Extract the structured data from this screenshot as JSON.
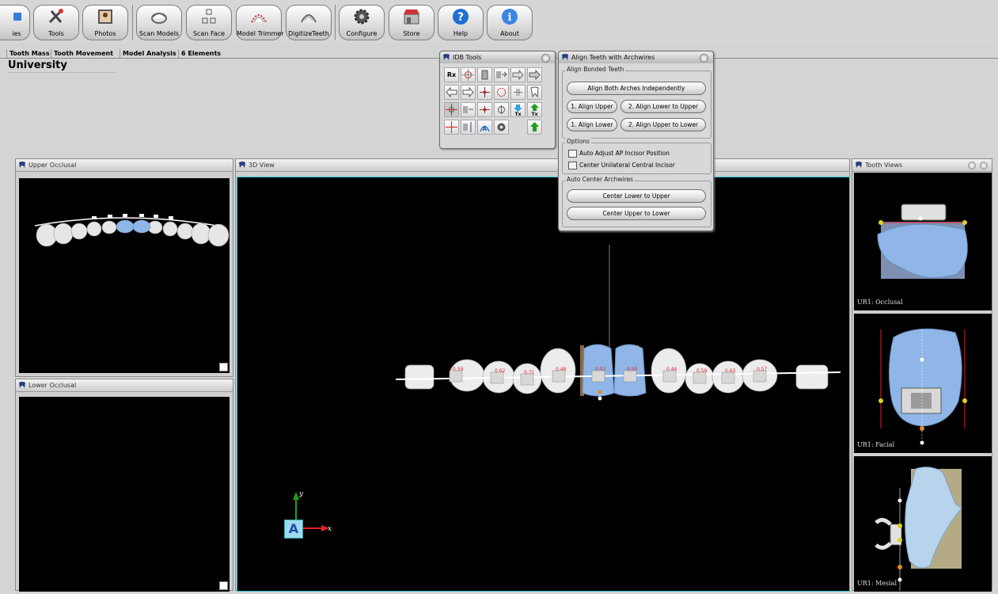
{
  "toolbar": {
    "buttons": [
      {
        "label": "ies",
        "icon": "blue-cube-icon"
      },
      {
        "label": "Tools",
        "icon": "tools-icon"
      },
      {
        "label": "Photos",
        "icon": "photo-icon"
      },
      {
        "label": "Scan Models",
        "icon": "scan-model-icon"
      },
      {
        "label": "Scan Face",
        "icon": "scan-face-icon"
      },
      {
        "label": "Model Trimmer",
        "icon": "model-trimmer-icon"
      },
      {
        "label": "DigitizeTeeth",
        "icon": "digitize-teeth-icon"
      },
      {
        "label": "Configure",
        "icon": "gear-icon"
      },
      {
        "label": "Store",
        "icon": "store-icon"
      },
      {
        "label": "Help",
        "icon": "help-icon"
      },
      {
        "label": "About",
        "icon": "info-icon"
      }
    ]
  },
  "tabs": [
    {
      "label": "Tooth Mass"
    },
    {
      "label": "Tooth Movement"
    },
    {
      "label": "Model Analysis"
    },
    {
      "label": "6 Elements"
    }
  ],
  "header": {
    "title": "University"
  },
  "panels": {
    "upper_occlusal": "Upper Occlusal",
    "lower_occlusal": "Lower Occlusal",
    "view3d": "3D View",
    "tooth_views": "Tooth Views"
  },
  "tooth_views": {
    "occlusal_label": "UR1: Occlusal",
    "facial_label": "UR1: Facial",
    "mesial_label": "UR1: Mesial"
  },
  "idb_tools": {
    "title": "IDB Tools",
    "rx_label": "Rx",
    "tx_label": "Tx",
    "a_label": "A"
  },
  "align_dialog": {
    "title": "Align Teeth with Archwires",
    "bonded_group": "Align Bonded Teeth",
    "align_both": "Align Both Arches Independently",
    "align_upper": "1. Align Upper",
    "align_lower_to_upper": "2. Align Lower to Upper",
    "align_lower": "1. Align Lower",
    "align_upper_to_lower": "2. Align Upper to Lower",
    "options_group": "Options",
    "opt_auto_adjust": "Auto Adjust AP Incisor Position",
    "opt_center_unilateral": "Center Unilateral Central Incisor",
    "opt_auto_adjust_checked": false,
    "opt_center_unilateral_checked": false,
    "center_group": "Auto Center Archwires",
    "center_lower": "Center Lower to Upper",
    "center_upper": "Center Upper to Lower"
  },
  "axes": {
    "y": "y",
    "x": "x",
    "cube": "A"
  },
  "colors": {
    "tooth_blue": "#8fb6e6",
    "accent_cyan": "#2fc6d9",
    "axis_green": "#1ea01e",
    "axis_red": "#e2202a"
  }
}
